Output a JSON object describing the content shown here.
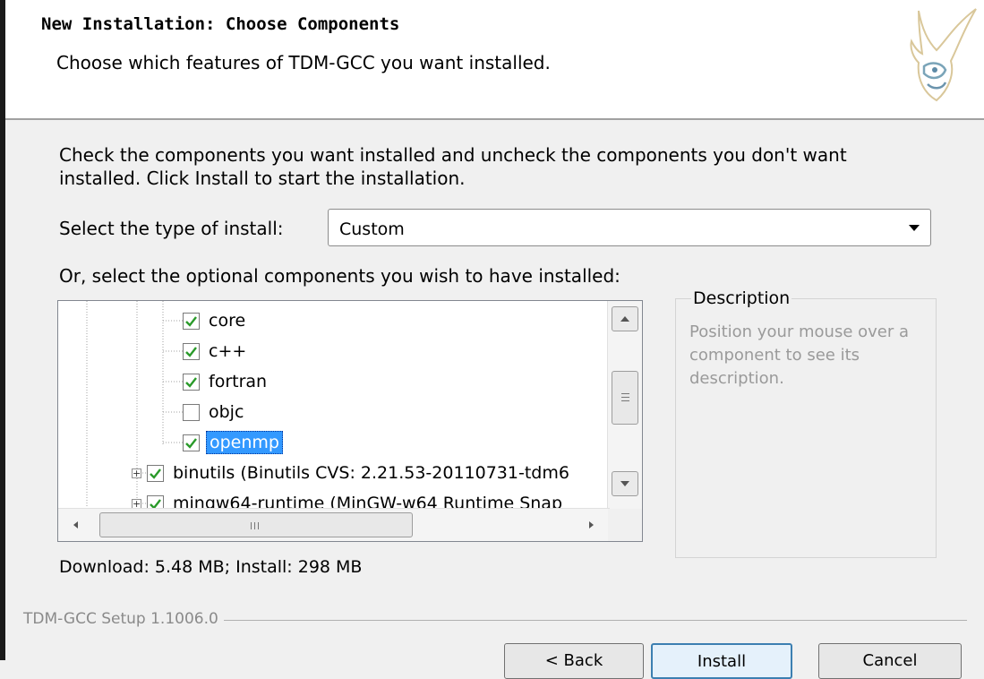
{
  "header": {
    "title": "New Installation: Choose Components",
    "subtitle": "Choose which features of TDM-GCC you want installed."
  },
  "main": {
    "instructions": "Check the components you want installed and uncheck the components you don't want installed. Click Install to start the installation.",
    "install_type": {
      "label": "Select the type of install:",
      "value": "Custom"
    },
    "optional_label": "Or, select the optional components you wish to have installed:",
    "components": [
      {
        "label": "core",
        "checked": true
      },
      {
        "label": "c++",
        "checked": true
      },
      {
        "label": "fortran",
        "checked": true
      },
      {
        "label": "objc",
        "checked": false
      },
      {
        "label": "openmp",
        "checked": true,
        "selected": true
      },
      {
        "label": "binutils (Binutils CVS: 2.21.53-20110731-tdm6",
        "checked": true
      },
      {
        "label": "mingw64-runtime (MinGW-w64 Runtime Snap",
        "checked": true
      }
    ],
    "description": {
      "title": "Description",
      "text": "Position your mouse over a component to see its description."
    },
    "space_required": "Download: 5.48 MB; Install: 298 MB"
  },
  "footer": {
    "brand": "TDM-GCC Setup 1.1006.0",
    "buttons": {
      "back": "< Back",
      "install": "Install",
      "cancel": "Cancel"
    }
  }
}
